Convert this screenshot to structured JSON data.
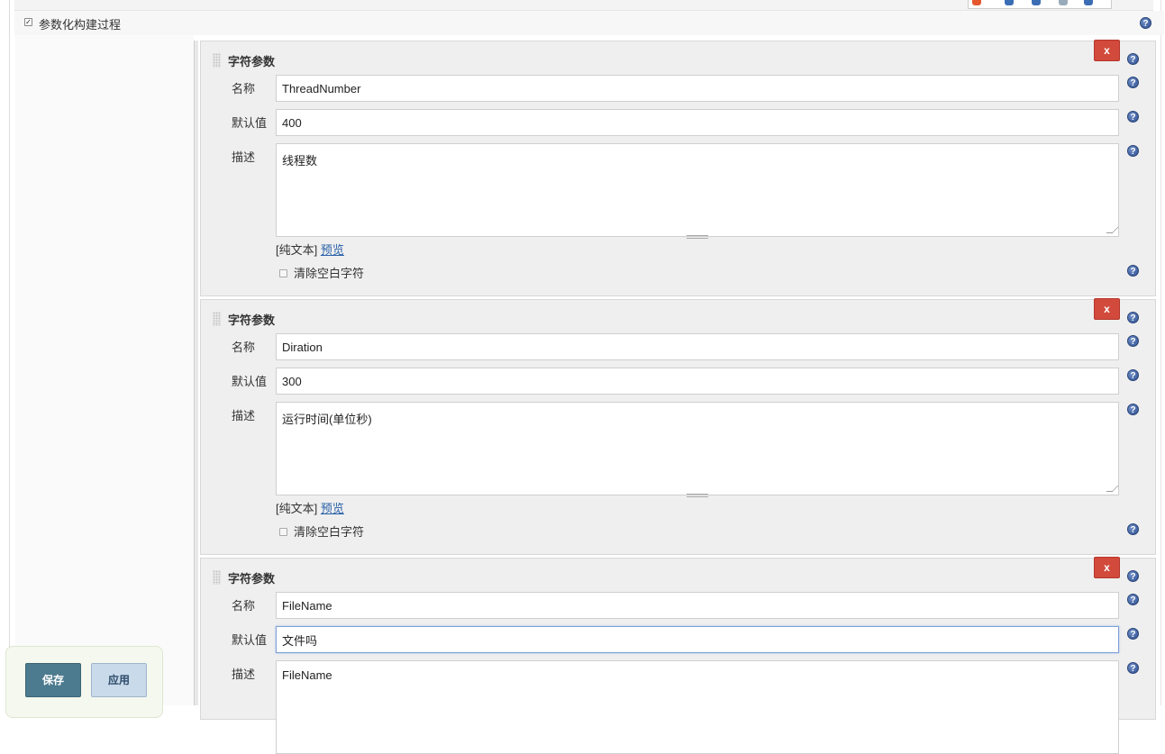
{
  "section": {
    "label": "参数化构建过程",
    "checked": true
  },
  "params": [
    {
      "title": "字符参数",
      "delete_label": "x",
      "name_label": "名称",
      "name_value": "ThreadNumber",
      "default_label": "默认值",
      "default_value": "400",
      "desc_label": "描述",
      "desc_value": "线程数",
      "format_plain": "[纯文本]",
      "format_preview": "预览",
      "trim_label": "清除空白字符"
    },
    {
      "title": "字符参数",
      "delete_label": "x",
      "name_label": "名称",
      "name_value": "Diration",
      "default_label": "默认值",
      "default_value": "300",
      "desc_label": "描述",
      "desc_value": "运行时间(单位秒)",
      "format_plain": "[纯文本]",
      "format_preview": "预览",
      "trim_label": "清除空白字符"
    },
    {
      "title": "字符参数",
      "delete_label": "x",
      "name_label": "名称",
      "name_value": "FileName",
      "default_label": "默认值",
      "default_value": "文件吗",
      "desc_label": "描述",
      "desc_value": "FileName"
    }
  ],
  "buttons": {
    "save": "保存",
    "apply": "应用"
  },
  "help_glyph": "?",
  "colors": {
    "delete": "#d24a3c",
    "save": "#4c7a8e",
    "apply": "#c9daea",
    "link": "#2960a8"
  }
}
